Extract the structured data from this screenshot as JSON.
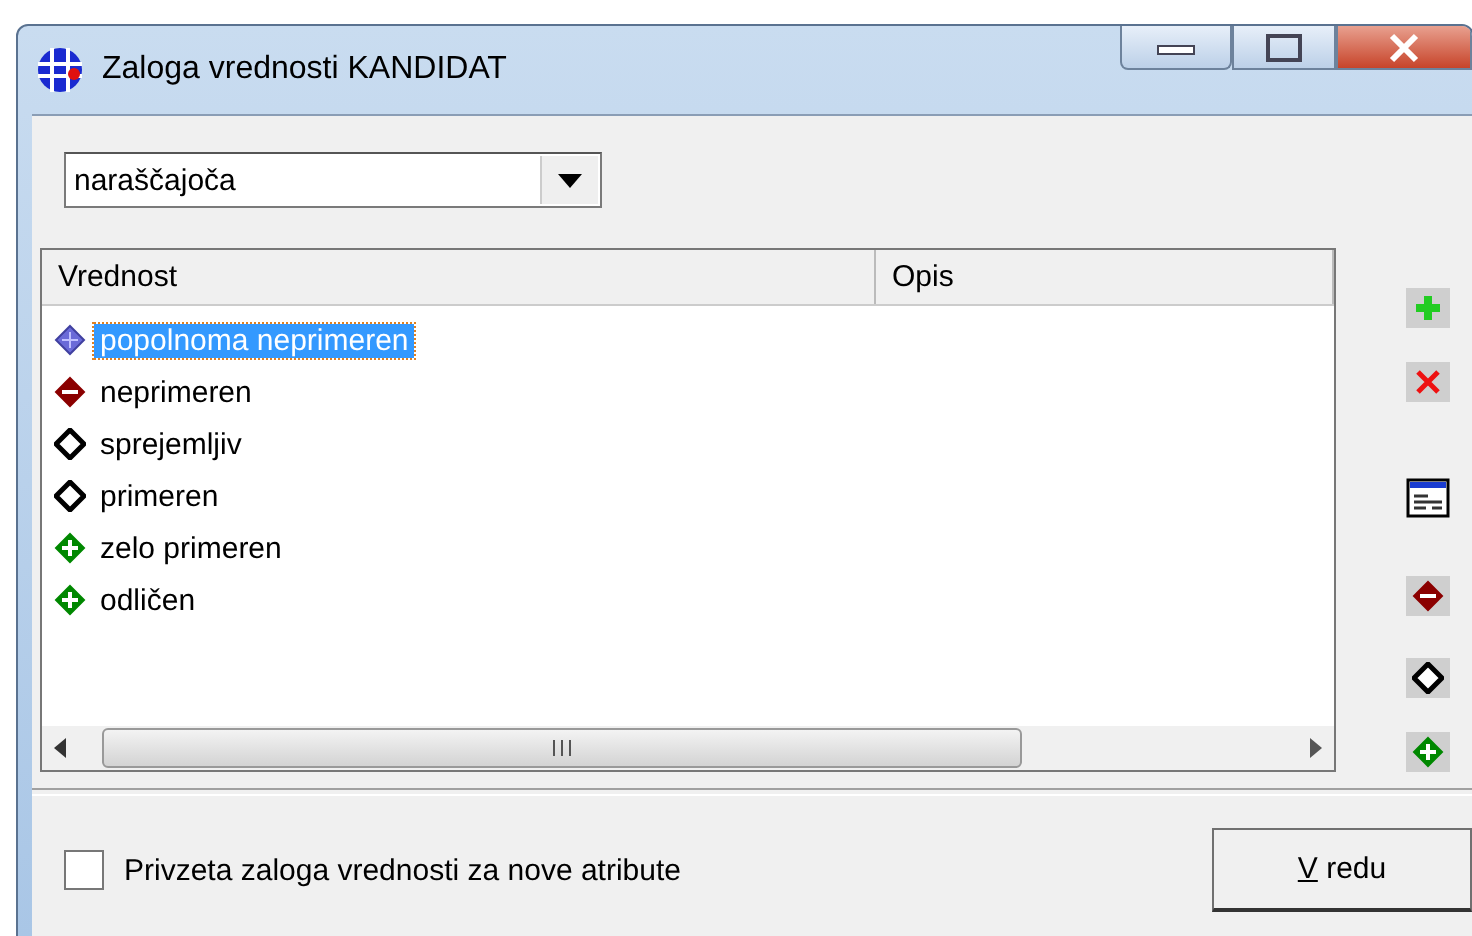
{
  "window": {
    "title": "Zaloga vrednosti KANDIDAT"
  },
  "sort_select": {
    "value": "naraščajoča"
  },
  "table": {
    "columns": [
      "Vrednost",
      "Opis"
    ],
    "rows": [
      {
        "value": "popolnoma neprimeren",
        "kind": "blue",
        "selected": true
      },
      {
        "value": "neprimeren",
        "kind": "minus",
        "selected": false
      },
      {
        "value": "sprejemljiv",
        "kind": "hollow",
        "selected": false
      },
      {
        "value": "primeren",
        "kind": "hollow",
        "selected": false
      },
      {
        "value": "zelo primeren",
        "kind": "plus",
        "selected": false
      },
      {
        "value": "odličen",
        "kind": "plus",
        "selected": false
      }
    ]
  },
  "toolbar": [
    {
      "kind": "add"
    },
    {
      "kind": "delete"
    },
    {
      "kind": "form"
    },
    {
      "kind": "minus"
    },
    {
      "kind": "hollow"
    },
    {
      "kind": "plus"
    }
  ],
  "default_checkbox": {
    "label": "Privzeta zaloga vrednosti za nove atribute",
    "checked": false
  },
  "ok_button": {
    "label": "V redu"
  }
}
